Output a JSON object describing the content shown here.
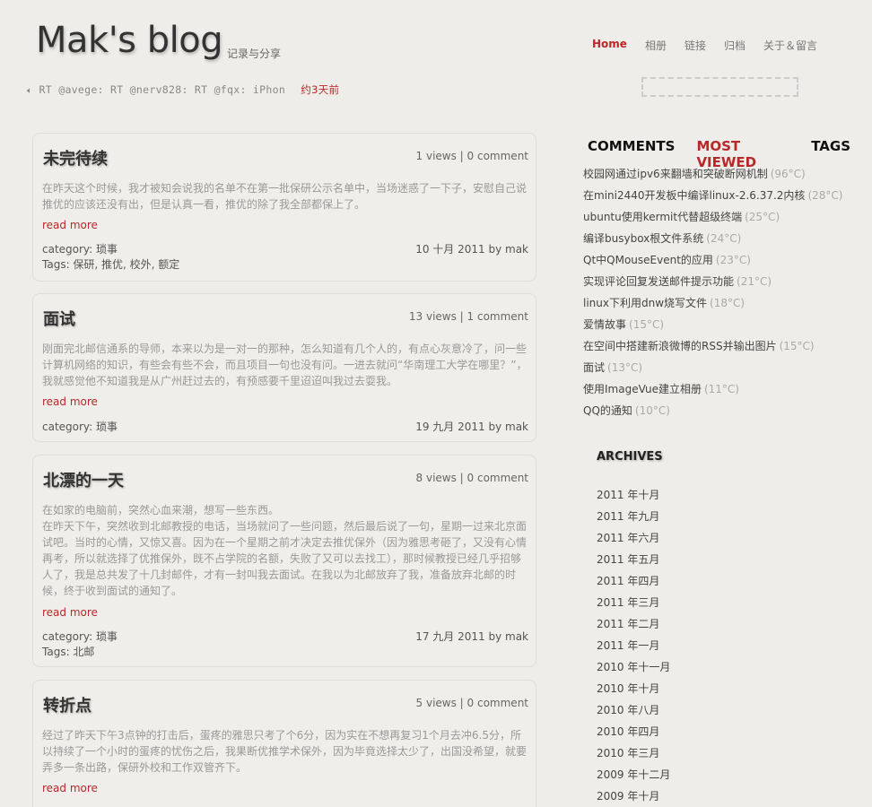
{
  "site": {
    "title": "Mak's blog",
    "subtitle": "记录与分享"
  },
  "nav": [
    {
      "label": "Home",
      "active": true
    },
    {
      "label": "相册"
    },
    {
      "label": "链接"
    },
    {
      "label": "归档"
    },
    {
      "label": "关于＆留言"
    }
  ],
  "tweet": {
    "text": "RT @avege: RT @nerv828: RT @fqx: iPhon",
    "time": "约3天前"
  },
  "posts": [
    {
      "title": "未完待续",
      "stats": "1 views | 0 comment",
      "excerpt": "在昨天这个时候，我才被知会说我的名单不在第一批保研公示名单中，当场迷惑了一下子，安慰自己说推优的应该还没有出，但是认真一看，推优的除了我全部都保上了。",
      "read_more": "read more",
      "category": "category: 琐事",
      "tags": "Tags: 保研, 推优, 校外, 额定",
      "date": "10 十月 2011 by mak"
    },
    {
      "title": "面试",
      "stats": "13 views | 1 comment",
      "excerpt": "刚面完北邮信通系的导师，本来以为是一对一的那种，怎么知道有几个人的，有点心灰意冷了，问一些计算机网络的知识，有些会有些不会，而且项目一句也没有问。一进去就问“华南理工大学在哪里？”，我就感觉他不知道我是从广州赶过去的，有预感要千里迢迢叫我过去耍我。",
      "read_more": "read more",
      "category": "category: 琐事",
      "tags": "",
      "date": "19 九月 2011 by mak"
    },
    {
      "title": "北漂的一天",
      "stats": "8 views | 0 comment",
      "excerpt_lines": [
        "在如家的电脑前，突然心血来潮，想写一些东西。",
        "在昨天下午，突然收到北邮教授的电话，当场就问了一些问题，然后最后说了一句，星期一过来北京面试吧。当时的心情，又惊又喜。因为在一个星期之前才决定去推优保外（因为雅思考砸了，又没有心情再考，所以就选择了优推保外，既不占学院的名额，失败了又可以去找工），那时候教授已经几乎招够人了，我是总共发了十几封邮件，才有一封叫我去面试。在我以为北邮放弃了我，准备放弃北邮的时候，终于收到面试的通知了。"
      ],
      "read_more": "read more",
      "category": "category: 琐事",
      "tags": "Tags: 北邮",
      "date": "17 九月 2011 by mak"
    },
    {
      "title": "转折点",
      "stats": "5 views | 0 comment",
      "excerpt": "经过了昨天下午3点钟的打击后，蛋疼的雅思只考了个6分，因为实在不想再复习1个月去冲6.5分，所以持续了一个小时的蛋疼的忧伤之后，我果断优推学术保外，因为毕竟选择太少了，出国没希望，就要弄多一条出路，保研外校和工作双管齐下。",
      "read_more": "read more"
    }
  ],
  "sidebar": {
    "tabs": [
      {
        "label": "COMMENTS"
      },
      {
        "label": "MOST VIEWED",
        "active": true
      },
      {
        "label": "TAGS"
      }
    ],
    "most_viewed": [
      {
        "title": "校园网通过ipv6来翻墙和突破断网机制",
        "temp": "(96°C)"
      },
      {
        "title": "在mini2440开发板中编译linux-2.6.37.2内核",
        "temp": "(28°C)"
      },
      {
        "title": "ubuntu使用kermit代替超级终端",
        "temp": "(25°C)"
      },
      {
        "title": "编译busybox根文件系统",
        "temp": "(24°C)"
      },
      {
        "title": "Qt中QMouseEvent的应用",
        "temp": "(23°C)"
      },
      {
        "title": "实现评论回复发送邮件提示功能",
        "temp": "(21°C)"
      },
      {
        "title": "linux下利用dnw烧写文件",
        "temp": "(18°C)"
      },
      {
        "title": "爱情故事",
        "temp": "(15°C)"
      },
      {
        "title": "在空间中搭建新浪微博的RSS并输出图片",
        "temp": "(15°C)"
      },
      {
        "title": "面试",
        "temp": "(13°C)"
      },
      {
        "title": "使用ImageVue建立相册",
        "temp": "(11°C)"
      },
      {
        "title": "QQ的通知",
        "temp": "(10°C)"
      }
    ],
    "archives_title": "ARCHIVES",
    "archives": [
      "2011 年十月",
      "2011 年九月",
      "2011 年六月",
      "2011 年五月",
      "2011 年四月",
      "2011 年三月",
      "2011 年二月",
      "2011 年一月",
      "2010 年十一月",
      "2010 年十月",
      "2010 年八月",
      "2010 年四月",
      "2010 年三月",
      "2009 年十二月",
      "2009 年十月"
    ]
  },
  "colors": {
    "accent": "#b8282a",
    "background": "#efede9"
  }
}
